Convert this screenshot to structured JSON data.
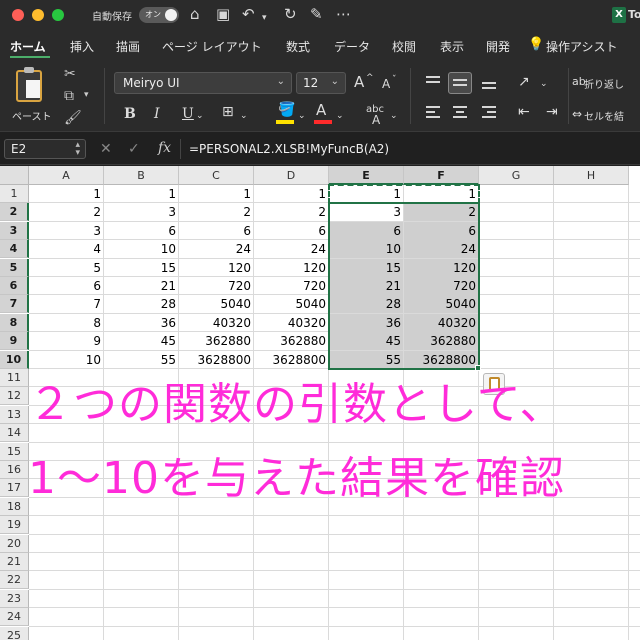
{
  "titlebar": {
    "autosave_label": "自動保存",
    "autosave_toggle": "オン",
    "app_badge": "X",
    "app_name": "To"
  },
  "ribbon_tabs": [
    "ホーム",
    "挿入",
    "描画",
    "ページ レイアウト",
    "数式",
    "データ",
    "校閲",
    "表示",
    "開発",
    "操作アシスト"
  ],
  "ribbon": {
    "paste_label": "ペースト",
    "font_name": "Meiryo UI",
    "font_size": "12",
    "grow_font": "A",
    "shrink_font": "A",
    "bold": "B",
    "italic": "I",
    "underline": "U",
    "font_color_letter": "A",
    "phonetic": "abc",
    "wrap_text": "折り返し",
    "merge_center": "セルを結",
    "fill_color": "#ffe100",
    "font_color": "#ff2b2b"
  },
  "formula_bar": {
    "name_box": "E2",
    "fx": "fx",
    "formula": "=PERSONAL2.XLSB!MyFuncB(A2)"
  },
  "sheet": {
    "columns": [
      "A",
      "B",
      "C",
      "D",
      "E",
      "F",
      "G",
      "H"
    ],
    "rows": [
      "1",
      "2",
      "3",
      "4",
      "5",
      "6",
      "7",
      "8",
      "9",
      "10",
      "11",
      "12",
      "13",
      "14",
      "15",
      "16",
      "17",
      "18",
      "19",
      "20",
      "21",
      "22",
      "23",
      "24",
      "25"
    ],
    "cells": [
      [
        "1",
        "1",
        "1",
        "1",
        "1",
        "1"
      ],
      [
        "2",
        "3",
        "2",
        "2",
        "3",
        "2"
      ],
      [
        "3",
        "6",
        "6",
        "6",
        "6",
        "6"
      ],
      [
        "4",
        "10",
        "24",
        "24",
        "10",
        "24"
      ],
      [
        "5",
        "15",
        "120",
        "120",
        "15",
        "120"
      ],
      [
        "6",
        "21",
        "720",
        "720",
        "21",
        "720"
      ],
      [
        "7",
        "28",
        "5040",
        "5040",
        "28",
        "5040"
      ],
      [
        "8",
        "36",
        "40320",
        "40320",
        "36",
        "40320"
      ],
      [
        "9",
        "45",
        "362880",
        "362880",
        "45",
        "362880"
      ],
      [
        "10",
        "55",
        "3628800",
        "3628800",
        "55",
        "3628800"
      ]
    ],
    "selection_color": "#217346"
  },
  "caption": {
    "line1": "２つの関数の引数として、",
    "line2": "1～10を与えた結果を確認",
    "color": "#ff2bd9"
  }
}
